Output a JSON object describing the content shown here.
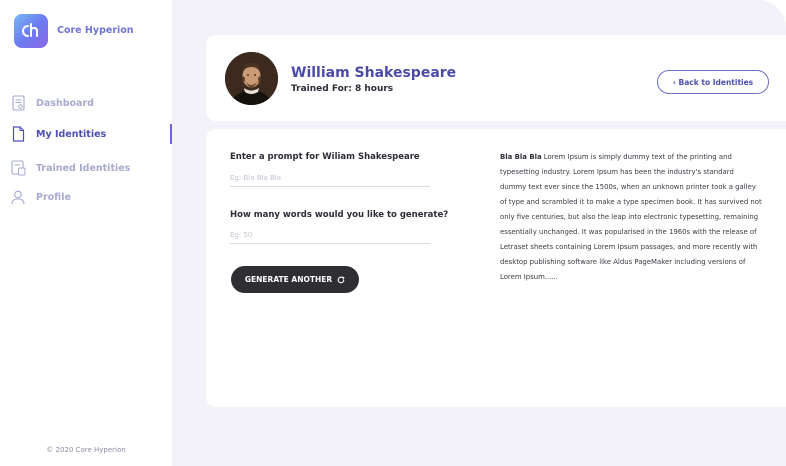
{
  "app": {
    "brand": "Core Hyperion",
    "footer": "© 2020 Core Hyperion"
  },
  "sidebar": {
    "items": [
      {
        "label": "Dashboard",
        "icon": "dashboard-doc-icon"
      },
      {
        "label": "My Identities",
        "icon": "document-icon",
        "active": true
      },
      {
        "label": "Trained Identities",
        "icon": "trained-doc-icon"
      },
      {
        "label": "Profile",
        "icon": "user-icon"
      }
    ]
  },
  "header": {
    "name": "William Shakespeare",
    "trained_for": "Trained For: 8 hours",
    "back_label": "‹ Back to Identities"
  },
  "form": {
    "prompt_label": "Enter a prompt for Wiliam Shakespeare",
    "prompt_placeholder": "Eg: Bla Bla Bla",
    "words_label": "How many words would you like to generate?",
    "words_placeholder": "Eg: 50",
    "generate_label": "GENERATE ANOTHER"
  },
  "output": {
    "lead": "Bla Bla Bla",
    "text": " Lorem Ipsum is simply dummy text of the printing and typesetting industry. Lorem Ipsum has been the industry's standard dummy text ever since the 1500s, when an unknown printer took a galley of type and scrambled it to make a type specimen book. It has survived not only five centuries, but also the leap into electronic typesetting, remaining essentially unchanged. It was popularised in the 1960s with the release of Letraset sheets containing Lorem Ipsum passages, and more recently with desktop publishing software like Aldus PageMaker including versions of Lorem Ipsum......"
  },
  "colors": {
    "accent": "#4c4aa8",
    "nav_inactive": "#a7a9cf",
    "button_dark": "#2f2f33",
    "page_bg": "#f2f2f8"
  }
}
